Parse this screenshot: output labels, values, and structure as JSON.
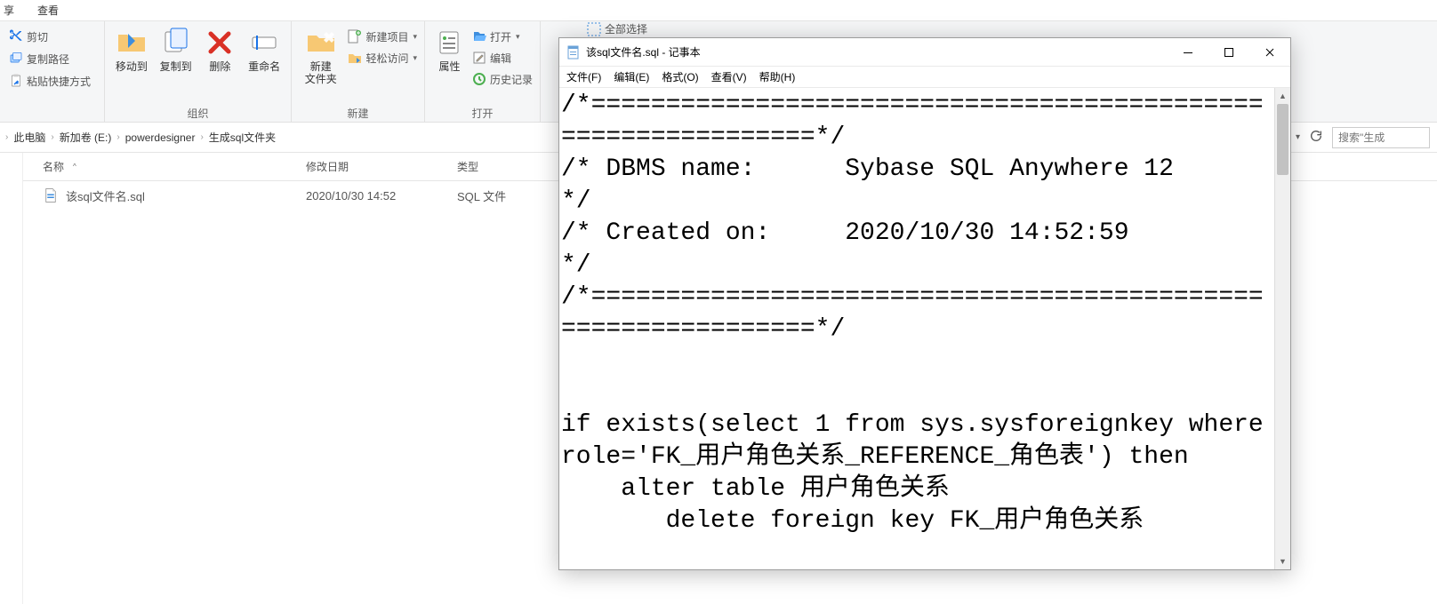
{
  "explorer": {
    "tabs": [
      "享",
      "查看"
    ],
    "ribbon": {
      "clipboard": {
        "cut": "剪切",
        "copy_path": "复制路径",
        "paste_shortcut": "粘贴快捷方式"
      },
      "organize": {
        "move_to": "移动到",
        "copy_to": "复制到",
        "delete": "删除",
        "rename": "重命名",
        "group_label": "组织"
      },
      "new": {
        "new_folder": "新建\n文件夹",
        "new_item": "新建项目",
        "easy_access": "轻松访问",
        "group_label": "新建"
      },
      "open": {
        "properties": "属性",
        "open": "打开",
        "edit": "编辑",
        "history": "历史记录",
        "group_label": "打开"
      },
      "select_all_peek": "全部选择"
    },
    "breadcrumb": [
      "此电脑",
      "新加卷 (E:)",
      "powerdesigner",
      "生成sql文件夹"
    ],
    "toolbar": {
      "search_placeholder": "搜索\"生成"
    },
    "columns": {
      "name": "名称",
      "modified": "修改日期",
      "type": "类型"
    },
    "files": [
      {
        "name": "该sql文件名.sql",
        "modified": "2020/10/30 14:52",
        "type": "SQL 文件"
      }
    ]
  },
  "notepad": {
    "title": "该sql文件名.sql - 记事本",
    "menu": [
      "文件(F)",
      "编辑(E)",
      "格式(O)",
      "查看(V)",
      "帮助(H)"
    ],
    "content": "/*==============================================================*/\n/* DBMS name:      Sybase SQL Anywhere 12                       */\n/* Created on:     2020/10/30 14:52:59                          */\n/*==============================================================*/\n\n\nif exists(select 1 from sys.sysforeignkey where role='FK_用户角色关系_REFERENCE_角色表') then\n    alter table 用户角色关系\n       delete foreign key FK_用户角色关系"
  }
}
